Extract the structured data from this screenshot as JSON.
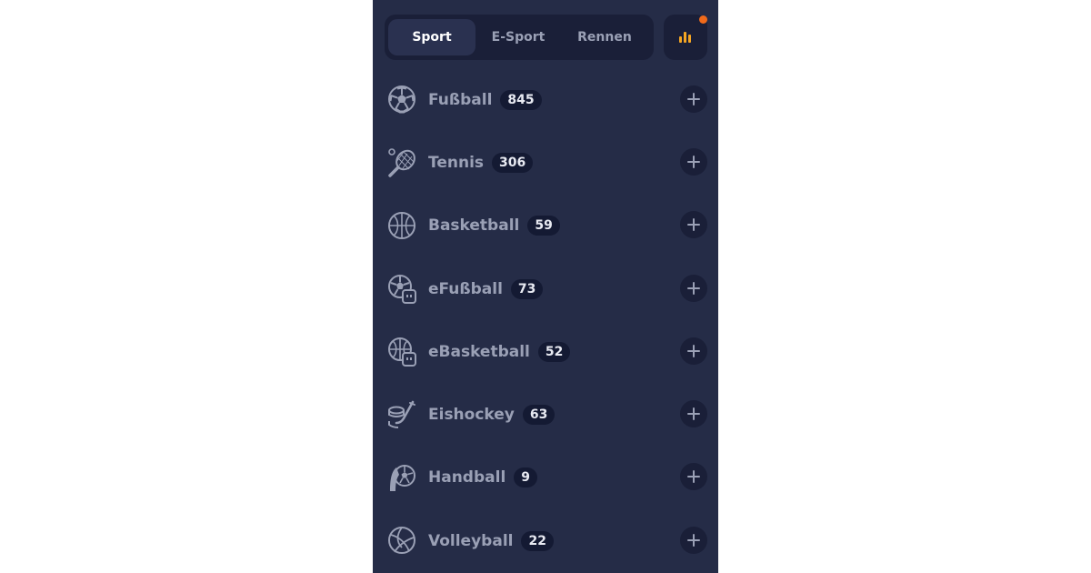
{
  "tabs": [
    {
      "label": "Sport",
      "active": true
    },
    {
      "label": "E-Sport",
      "active": false
    },
    {
      "label": "Rennen",
      "active": false
    }
  ],
  "stats_button": {
    "icon": "bar-chart-icon",
    "accent_color": "#f5a623",
    "notification_dot_color": "#f06a1b"
  },
  "sports": [
    {
      "label": "Fußball",
      "count": "845",
      "icon": "soccer-ball-icon"
    },
    {
      "label": "Tennis",
      "count": "306",
      "icon": "tennis-racket-icon"
    },
    {
      "label": "Basketball",
      "count": "59",
      "icon": "basketball-icon"
    },
    {
      "label": "eFußball",
      "count": "73",
      "icon": "esoccer-icon"
    },
    {
      "label": "eBasketball",
      "count": "52",
      "icon": "ebasketball-icon"
    },
    {
      "label": "Eishockey",
      "count": "63",
      "icon": "ice-hockey-icon"
    },
    {
      "label": "Handball",
      "count": "9",
      "icon": "handball-icon"
    },
    {
      "label": "Volleyball",
      "count": "22",
      "icon": "volleyball-icon"
    }
  ],
  "colors": {
    "panel_bg": "#252c47",
    "control_bg": "#1a1f38",
    "badge_bg": "#141a33",
    "label_text": "#9aa0b5",
    "active_tab_text": "#ffffff"
  }
}
